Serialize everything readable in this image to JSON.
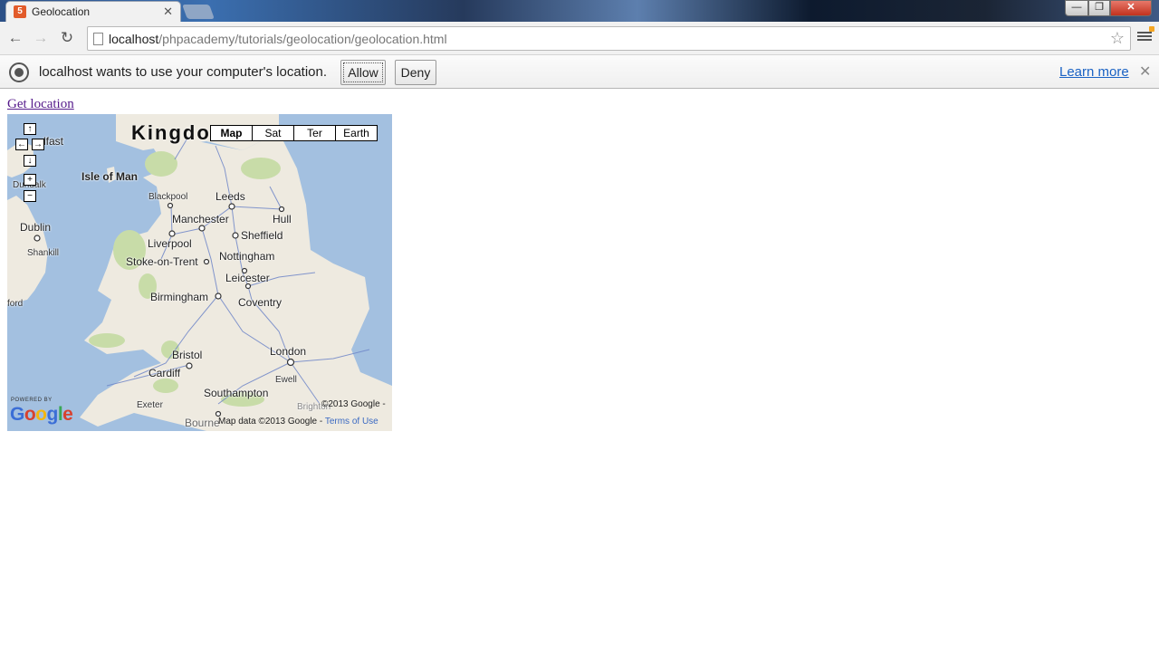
{
  "window": {
    "tab_title": "Geolocation",
    "tab_close": "✕",
    "min_label": "—",
    "max_label": "❐",
    "close_label": "✕"
  },
  "toolbar": {
    "back_icon": "←",
    "forward_icon": "→",
    "reload_icon": "↻",
    "url_host": "localhost",
    "url_path": "/phpacademy/tutorials/geolocation/geolocation.html",
    "star_icon": "☆"
  },
  "infobar": {
    "message": "localhost wants to use your computer's location.",
    "allow_label": "Allow",
    "deny_label": "Deny",
    "learn_more_label": "Learn more",
    "close_icon": "✕"
  },
  "page": {
    "get_location_link": "Get location"
  },
  "map": {
    "country_label": "Kingdo",
    "map_types": [
      "Map",
      "Sat",
      "Ter",
      "Earth"
    ],
    "selected_map_type": "Map",
    "pan_up": "↑",
    "pan_left": "←",
    "pan_right": "→",
    "pan_down": "↓",
    "zoom_in": "+",
    "zoom_out": "−",
    "cities": {
      "belfast": "lfast",
      "isle_of_man": "Isle of Man",
      "blackpool": "Blackpool",
      "leeds": "Leeds",
      "manchester": "Manchester",
      "hull": "Hull",
      "dundalk": "Dundalk",
      "dublin": "Dublin",
      "shankill": "Shankill",
      "liverpool": "Liverpool",
      "sheffield": "Sheffield",
      "nottingham": "Nottingham",
      "stoke": "Stoke-on-Trent",
      "leicester": "Leicester",
      "coventry": "Coventry",
      "birmingham": "Birmingham",
      "ford": "ford",
      "london": "London",
      "bristol": "Bristol",
      "ewell": "Ewell",
      "cardiff": "Cardiff",
      "southampton": "Southampton",
      "exeter": "Exeter",
      "brighton": "Brighton",
      "bournemouth": "Bourne"
    },
    "copyright": "©2013 Google -",
    "map_data_prefix": "Map data ©2013 Google - ",
    "terms_label": "Terms of Use",
    "powered_by": "POWERED BY",
    "google_logo": "Google"
  },
  "colors": {
    "water": "#a3c0e0",
    "land": "#eeeae0",
    "park": "#c8dca8",
    "road": "#6f86c8",
    "link_visited": "#551a8b",
    "learn_more": "#1a62c4"
  }
}
